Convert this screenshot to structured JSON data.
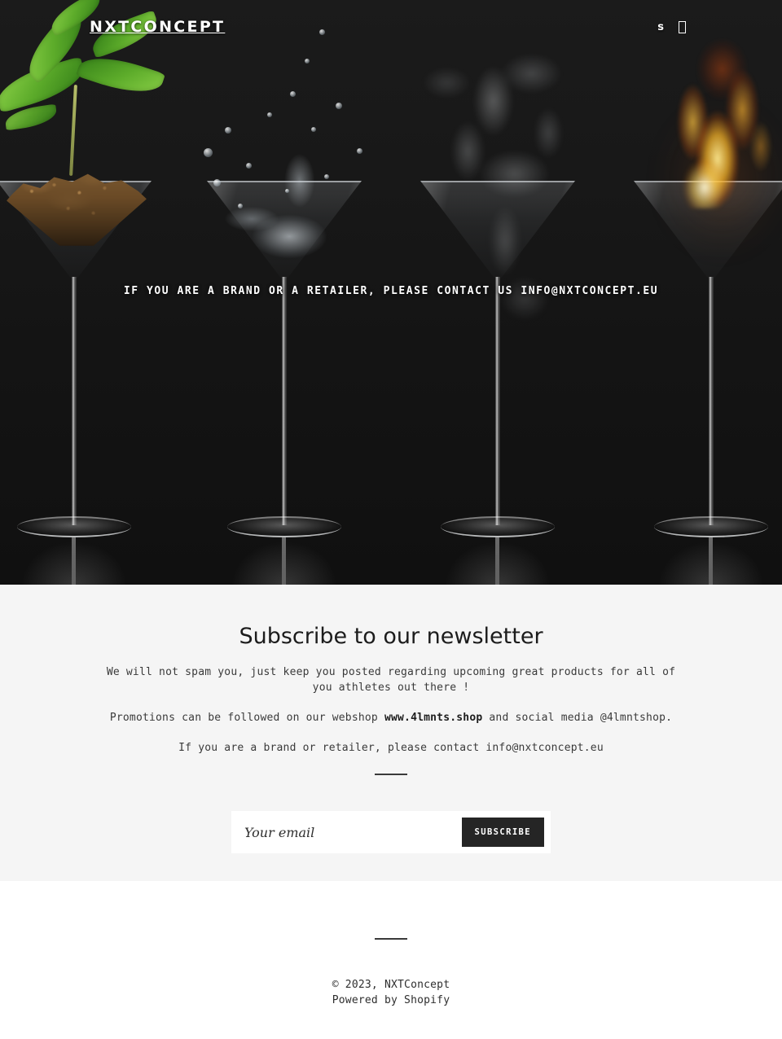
{
  "header": {
    "logo": "NXTCONCEPT",
    "search_icon": "search-icon",
    "search_glyph": "s",
    "cart_icon": "cart-icon"
  },
  "hero": {
    "banner_text": "IF YOU ARE A BRAND OR A RETAILER, PLEASE CONTACT US INFO@NXTCONCEPT.EU",
    "image_description": "four martini glasses with earth, water, smoke and fire",
    "background_color": "#111111"
  },
  "newsletter": {
    "title": "Subscribe to our newsletter",
    "paragraph_1": "We will not spam you, just keep you posted regarding upcoming great products for all of you athletes out there !",
    "paragraph_2_pre": "Promotions can be followed on our webshop ",
    "paragraph_2_link": "www.4lmnts.shop",
    "paragraph_2_post": " and social media @4lmntshop.",
    "paragraph_3": "If you are a brand or retailer, please contact info@nxtconcept.eu",
    "email_placeholder": "Your email",
    "email_value": "",
    "submit_label": "SUBSCRIBE",
    "background_color": "#f5f5f5"
  },
  "footer": {
    "copyright": "© 2023, NXTConcept",
    "powered_by_pre": "Powered by ",
    "powered_by_link": "Shopify"
  }
}
